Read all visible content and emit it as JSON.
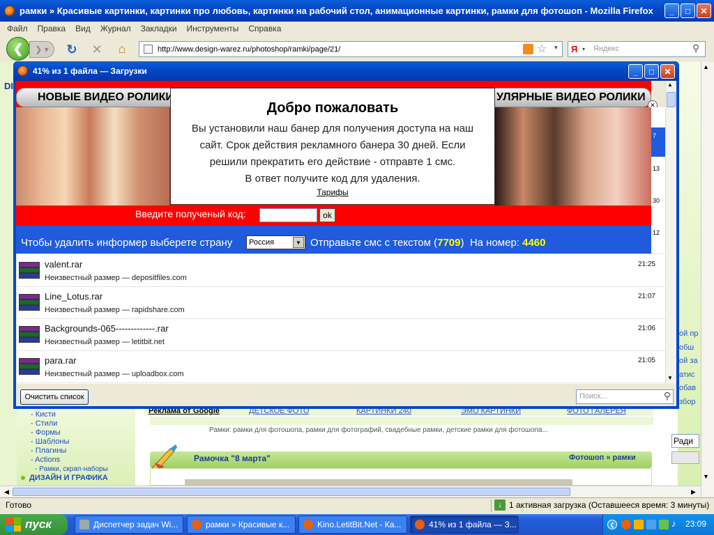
{
  "browser": {
    "title": "рамки » Красивые картинки, картинки про любовь, картинки на рабочий стол, анимационные картинки, рамки для фотошоп - Mozilla Firefox",
    "menu": [
      "Файл",
      "Правка",
      "Вид",
      "Журнал",
      "Закладки",
      "Инструменты",
      "Справка"
    ],
    "url": "http://www.design-warez.ru/photoshop/ramki/page/21/",
    "search_placeholder": "Яндекс",
    "search_engine_letter": "Я",
    "status_left": "Готово",
    "status_right": "1 активная загрузка (Оставшееся время: 3 минуты)"
  },
  "downloads": {
    "title": "41% из 1 файла — Загрузки",
    "items": [
      {
        "name": "valent.rar",
        "sub": "Неизвестный размер — depositfiles.com",
        "time": "21:25"
      },
      {
        "name": "Line_Lotus.rar",
        "sub": "Неизвестный размер — rapidshare.com",
        "time": "21:07"
      },
      {
        "name": "Backgrounds-065-------------.rar",
        "sub": "Неизвестный размер — letitbit.net",
        "time": "21:06"
      },
      {
        "name": "para.rar",
        "sub": "Неизвестный размер — uploadbox.com",
        "time": "21:05"
      }
    ],
    "clear_button": "Очистить список",
    "search_placeholder": "Поиск..."
  },
  "banner": {
    "header_left": "НОВЫЕ ВИДЕО РОЛИКИ",
    "header_right": "УЛЯРНЫЕ ВИДЕО РОЛИКИ",
    "popup_title": "Добро пожаловать",
    "popup_text_1": "Вы установили наш банер для получения доступа на наш",
    "popup_text_2": "сайт. Срок действия рекламного банера 30 дней. Если",
    "popup_text_3": "решили прекратить его действие - отправте 1 смс.",
    "popup_text_4": "В ответ получите код для удаления.",
    "popup_link": "Тарифы",
    "code_label": "Введите полученый код:",
    "ok_label": "ok",
    "country_prompt": "Чтобы удалить информер выберете страну",
    "country_value": "Россия",
    "sms_text_a": "Отправьте смс с текстом (",
    "sms_code": "7709",
    "sms_text_b": ")  На номер: ",
    "sms_number": "4460"
  },
  "page": {
    "sidebar_items": [
      "- Кисти",
      "- Стили",
      "- Формы",
      "- Шаблоны",
      "- Плагины",
      "- Actions",
      "- Рамки, скрап-наборы"
    ],
    "sidebar_section": "ДИЗАЙН И ГРАФИКА",
    "ads_label": "Реклама от Google",
    "ad_links": [
      "ДЕТСКОЕ ФОТО",
      "КАРТИНКИ 240",
      "ЭМО КАРТИНКИ",
      "ФОТО ГАЛЕРЕЯ"
    ],
    "category_text": "Рамки: рамки для фотошопа, рамки для фотографий, свадебные рамки, детские рамки для фотошопа...",
    "post_title": "Рамочка \"8 марта\"",
    "post_breadcrumb": "Фотошоп » рамки",
    "right_fragments": [
      "ой пр",
      "обш",
      "ой за",
      "атис",
      "обав",
      "збор"
    ],
    "right_radio": "Ради",
    "left_logo": "DI",
    "right_numbers": [
      "7",
      "13",
      "30",
      "12"
    ]
  },
  "taskbar": {
    "start": "пуск",
    "buttons": [
      "Диспетчер задач Wi...",
      "рамки » Красивые к...",
      "Kino.LetitBit.Net - Ка...",
      "41% из 1 файла — З..."
    ],
    "clock": "23:09"
  },
  "colors": {
    "xp_blue": "#0548c8",
    "banner_red": "#ff0000",
    "banner_blue": "#1f5bdc",
    "sms_yellow": "#ffff00",
    "page_green": "#c8e89a"
  }
}
